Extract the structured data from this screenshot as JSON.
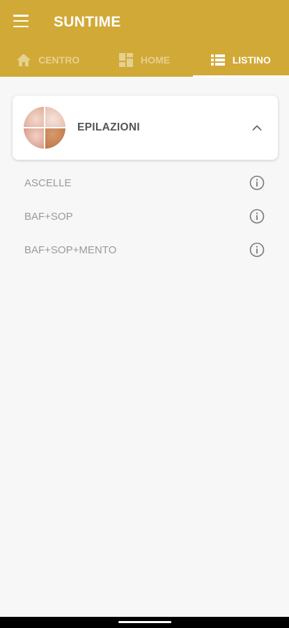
{
  "app": {
    "title": "SUNTIME"
  },
  "tabs": [
    {
      "label": "CENTRO",
      "icon": "home-icon",
      "active": false
    },
    {
      "label": "HOME",
      "icon": "dashboard-icon",
      "active": false
    },
    {
      "label": "LISTINO",
      "icon": "list-icon",
      "active": true
    }
  ],
  "category": {
    "title": "EPILAZIONI",
    "expanded": true,
    "icon": "chevron-up-icon"
  },
  "items": [
    {
      "label": "ASCELLE"
    },
    {
      "label": "BAF+SOP"
    },
    {
      "label": "BAF+SOP+MENTO"
    }
  ],
  "colors": {
    "accent": "#d1a936",
    "background": "#f7f7f7",
    "title_text": "#555555",
    "item_text": "#9a9a9a"
  }
}
